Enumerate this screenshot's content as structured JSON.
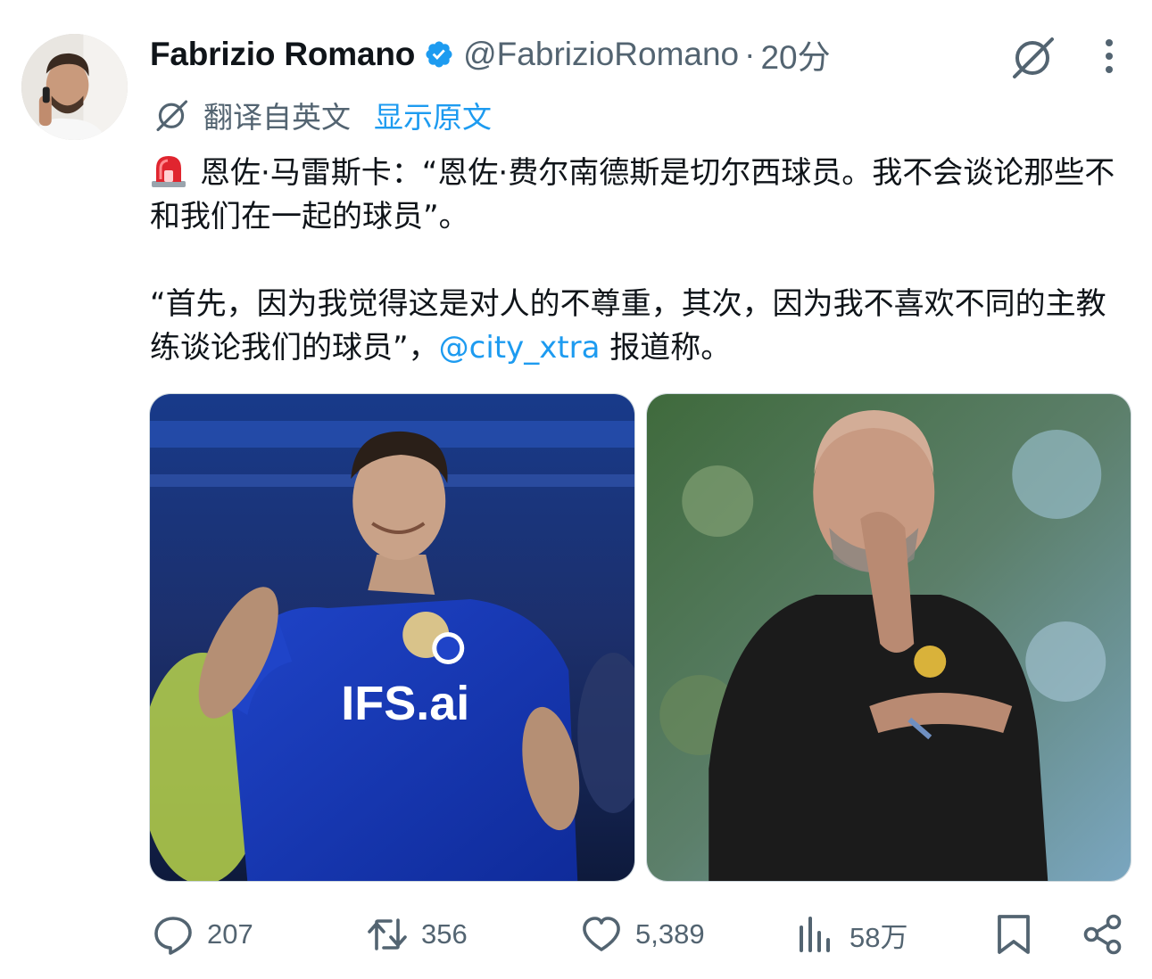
{
  "post": {
    "author_name": "Fabrizio Romano",
    "author_handle": "@FabrizioRomano",
    "separator": "·",
    "time": "20分",
    "translation": {
      "label": "翻译自英文",
      "show_original": "显示原文"
    },
    "body": {
      "p1_text": "恩佐·马雷斯卡：“恩佐·费尔南德斯是切尔西球员。我不会谈论那些不和我们在一起的球员”。",
      "p2_text_before": "“首先，因为我觉得这是对人的不尊重，其次，因为我不喜欢不同的主教练谈论我们的球员”，",
      "mention": "@city_xtra",
      "p2_text_after": " 报道称。"
    },
    "media": [
      {
        "icon": "chelsea-player-photo"
      },
      {
        "icon": "manager-photo"
      }
    ],
    "actions": {
      "replies": "207",
      "reposts": "356",
      "likes": "5,389",
      "views": "58万"
    }
  },
  "colors": {
    "text_primary": "#0f1419",
    "text_secondary": "#536471",
    "accent": "#1d9bf0"
  }
}
